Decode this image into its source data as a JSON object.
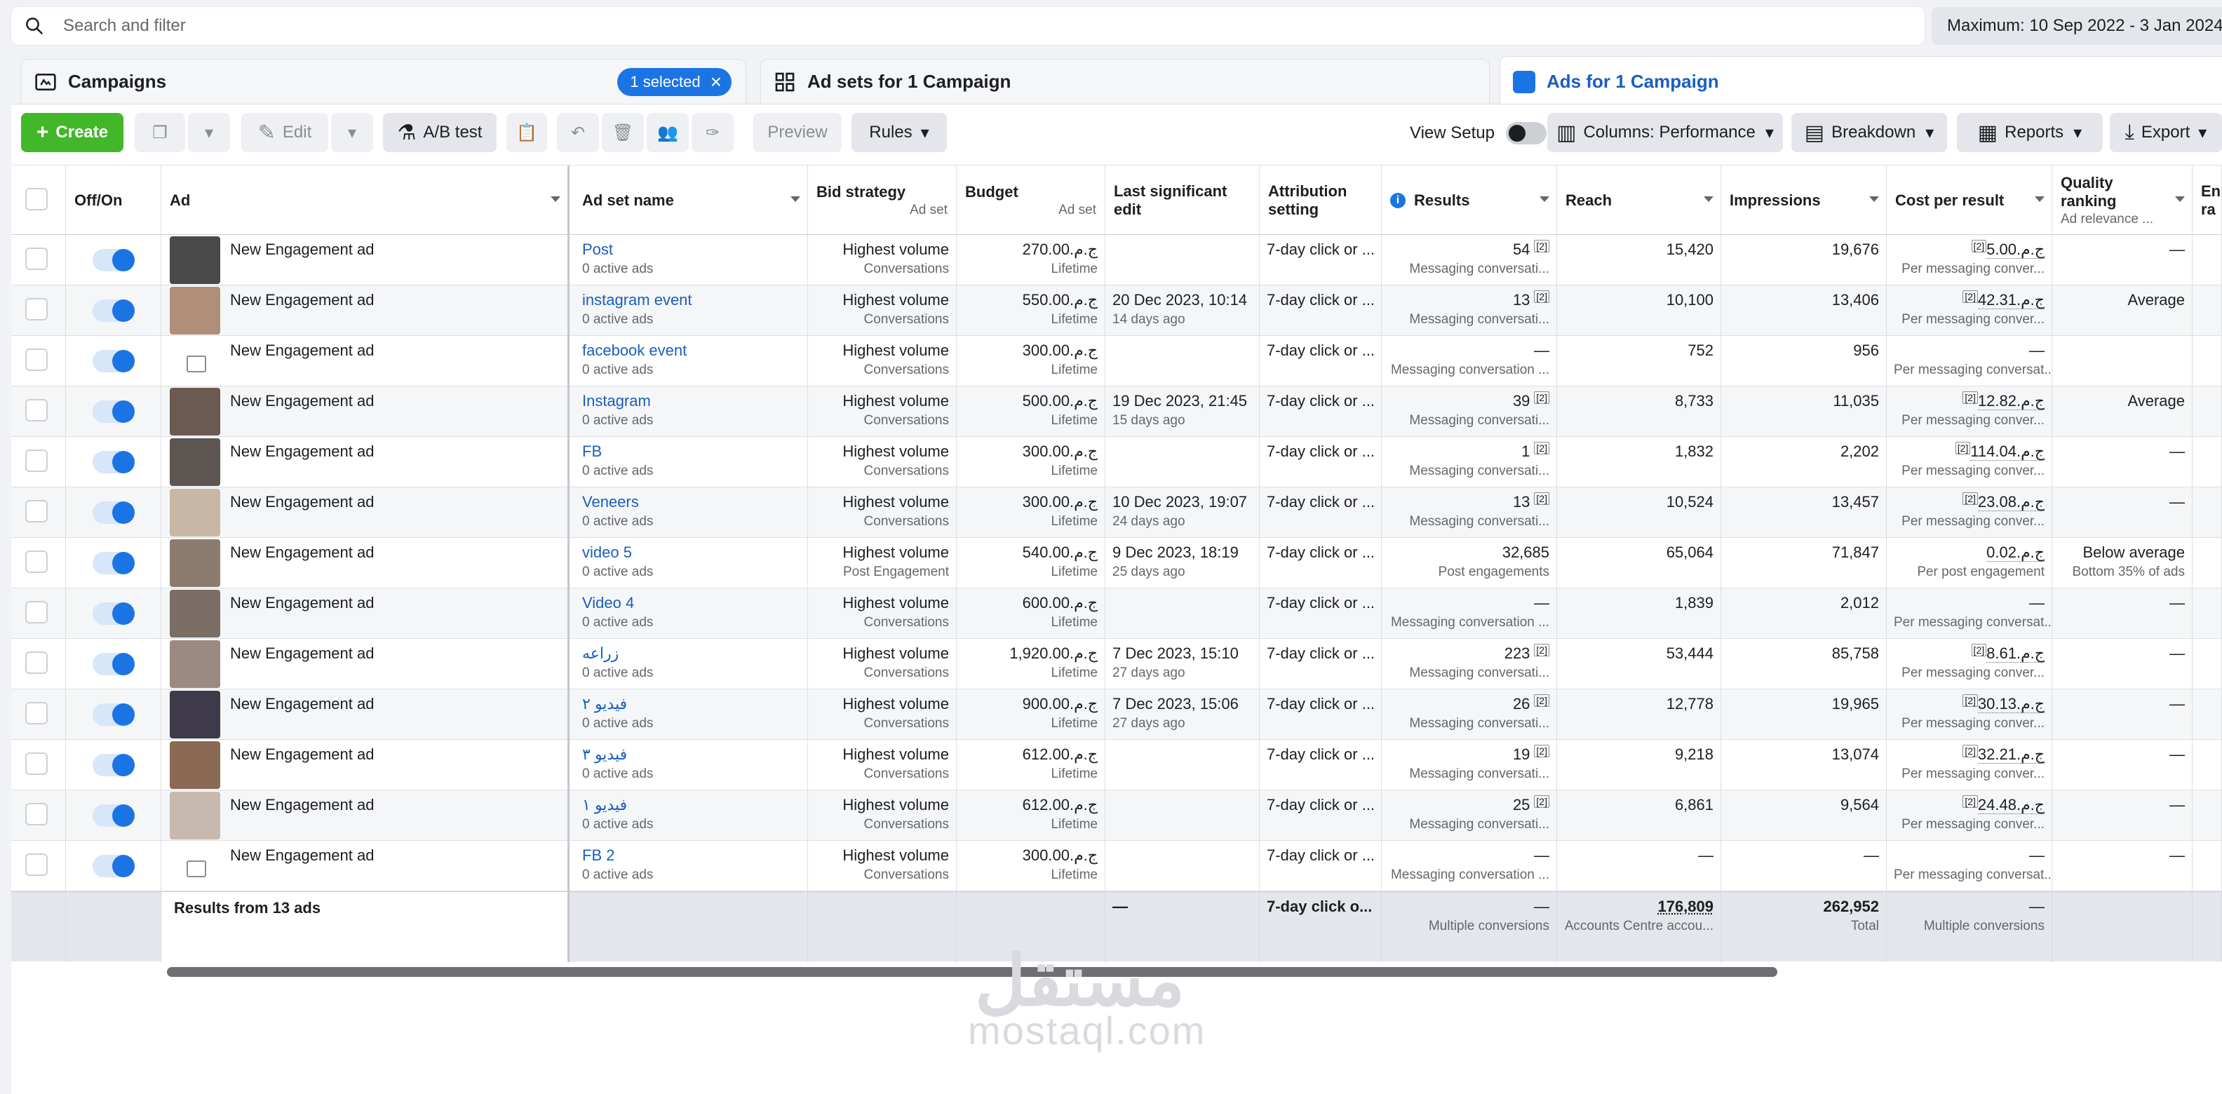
{
  "search": {
    "placeholder": "Search and filter"
  },
  "date_range": "Maximum: 10 Sep 2022 - 3 Jan 2024",
  "tabs": {
    "campaigns": "Campaigns",
    "selected_pill": "1 selected",
    "adsets": "Ad sets for 1 Campaign",
    "ads": "Ads for 1 Campaign"
  },
  "toolbar": {
    "create": "Create",
    "edit": "Edit",
    "ab_test": "A/B test",
    "preview": "Preview",
    "rules": "Rules",
    "view_setup": "View Setup",
    "columns": "Columns: Performance",
    "breakdown": "Breakdown",
    "reports": "Reports",
    "export": "Export"
  },
  "headers": {
    "offon": "Off/On",
    "ad": "Ad",
    "adset": "Ad set name",
    "bid": "Bid strategy",
    "bid_sub": "Ad set",
    "budget": "Budget",
    "budget_sub": "Ad set",
    "lastedit": "Last significant edit",
    "attribution": "Attribution setting",
    "results": "Results",
    "reach": "Reach",
    "impressions": "Impressions",
    "cpr": "Cost per result",
    "quality": "Quality ranking",
    "quality_sub": "Ad relevance ...",
    "er": "En ra"
  },
  "rows": [
    {
      "ad": "New Engagement ad",
      "adset": "Post",
      "adset_sub": "0 active ads",
      "bid": "Highest volume",
      "bid_sub": "Conversations",
      "budget": "ج.م.270.00",
      "budget_sub": "Lifetime",
      "edit": "",
      "edit_sub": "",
      "attr": "7-day click or ...",
      "results": "54",
      "results_sub": "Messaging conversati...",
      "reach": "15,420",
      "impr": "19,676",
      "cpr": "ج.م.5.00",
      "cpr_sub": "Per messaging conver...",
      "quality": "—",
      "quality_sub": "",
      "thumb": "#4a4a4a"
    },
    {
      "ad": "New Engagement ad",
      "adset": "instagram event",
      "adset_sub": "0 active ads",
      "bid": "Highest volume",
      "bid_sub": "Conversations",
      "budget": "ج.م.550.00",
      "budget_sub": "Lifetime",
      "edit": "20 Dec 2023, 10:14",
      "edit_sub": "14 days ago",
      "attr": "7-day click or ...",
      "results": "13",
      "results_sub": "Messaging conversati...",
      "reach": "10,100",
      "impr": "13,406",
      "cpr": "ج.م.42.31",
      "cpr_sub": "Per messaging conver...",
      "quality": "Average",
      "quality_sub": "",
      "thumb": "#b08f7a"
    },
    {
      "ad": "New Engagement ad",
      "adset": "facebook event",
      "adset_sub": "0 active ads",
      "bid": "Highest volume",
      "bid_sub": "Conversations",
      "budget": "ج.م.300.00",
      "budget_sub": "Lifetime",
      "edit": "",
      "edit_sub": "",
      "attr": "7-day click or ...",
      "results": "—",
      "results_sub": "Messaging conversation ...",
      "reach": "752",
      "impr": "956",
      "cpr": "—",
      "cpr_sub": "Per messaging conversat...",
      "quality": "",
      "quality_sub": "",
      "thumb": ""
    },
    {
      "ad": "New Engagement ad",
      "adset": "Instagram",
      "adset_sub": "0 active ads",
      "bid": "Highest volume",
      "bid_sub": "Conversations",
      "budget": "ج.م.500.00",
      "budget_sub": "Lifetime",
      "edit": "19 Dec 2023, 21:45",
      "edit_sub": "15 days ago",
      "attr": "7-day click or ...",
      "results": "39",
      "results_sub": "Messaging conversati...",
      "reach": "8,733",
      "impr": "11,035",
      "cpr": "ج.م.12.82",
      "cpr_sub": "Per messaging conver...",
      "quality": "Average",
      "quality_sub": "",
      "thumb": "#6b5a52"
    },
    {
      "ad": "New Engagement ad",
      "adset": "FB",
      "adset_sub": "0 active ads",
      "bid": "Highest volume",
      "bid_sub": "Conversations",
      "budget": "ج.م.300.00",
      "budget_sub": "Lifetime",
      "edit": "",
      "edit_sub": "",
      "attr": "7-day click or ...",
      "results": "1",
      "results_sub": "Messaging conversati...",
      "reach": "1,832",
      "impr": "2,202",
      "cpr": "ج.م.114.04",
      "cpr_sub": "Per messaging conver...",
      "quality": "—",
      "quality_sub": "",
      "thumb": "#5c5552"
    },
    {
      "ad": "New Engagement ad",
      "adset": "Veneers",
      "adset_sub": "0 active ads",
      "bid": "Highest volume",
      "bid_sub": "Conversations",
      "budget": "ج.م.300.00",
      "budget_sub": "Lifetime",
      "edit": "10 Dec 2023, 19:07",
      "edit_sub": "24 days ago",
      "attr": "7-day click or ...",
      "results": "13",
      "results_sub": "Messaging conversati...",
      "reach": "10,524",
      "impr": "13,457",
      "cpr": "ج.م.23.08",
      "cpr_sub": "Per messaging conver...",
      "quality": "—",
      "quality_sub": "",
      "thumb": "#c9b7a5"
    },
    {
      "ad": "New Engagement ad",
      "adset": "video 5",
      "adset_sub": "0 active ads",
      "bid": "Highest volume",
      "bid_sub": "Post Engagement",
      "budget": "ج.م.540.00",
      "budget_sub": "Lifetime",
      "edit": "9 Dec 2023, 18:19",
      "edit_sub": "25 days ago",
      "attr": "7-day click or ...",
      "results": "32,685",
      "results_sub": "Post engagements",
      "reach": "65,064",
      "impr": "71,847",
      "cpr": "ج.م.0.02",
      "cpr_sub": "Per post engagement",
      "quality": "Below average",
      "quality_sub": "Bottom 35% of ads",
      "thumb": "#8c7b6f"
    },
    {
      "ad": "New Engagement ad",
      "adset": "Video 4",
      "adset_sub": "0 active ads",
      "bid": "Highest volume",
      "bid_sub": "Conversations",
      "budget": "ج.م.600.00",
      "budget_sub": "Lifetime",
      "edit": "",
      "edit_sub": "",
      "attr": "7-day click or ...",
      "results": "—",
      "results_sub": "Messaging conversation ...",
      "reach": "1,839",
      "impr": "2,012",
      "cpr": "—",
      "cpr_sub": "Per messaging conversat...",
      "quality": "—",
      "quality_sub": "",
      "thumb": "#7a6e66"
    },
    {
      "ad": "New Engagement ad",
      "adset": "زراعه",
      "adset_sub": "0 active ads",
      "bid": "Highest volume",
      "bid_sub": "Conversations",
      "budget": "ج.م.1,920.00",
      "budget_sub": "Lifetime",
      "edit": "7 Dec 2023, 15:10",
      "edit_sub": "27 days ago",
      "attr": "7-day click or ...",
      "results": "223",
      "results_sub": "Messaging conversati...",
      "reach": "53,444",
      "impr": "85,758",
      "cpr": "ج.م.8.61",
      "cpr_sub": "Per messaging conver...",
      "quality": "—",
      "quality_sub": "",
      "thumb": "#9a8a80"
    },
    {
      "ad": "New Engagement ad",
      "adset": "فيديو ٢",
      "adset_sub": "0 active ads",
      "bid": "Highest volume",
      "bid_sub": "Conversations",
      "budget": "ج.م.900.00",
      "budget_sub": "Lifetime",
      "edit": "7 Dec 2023, 15:06",
      "edit_sub": "27 days ago",
      "attr": "7-day click or ...",
      "results": "26",
      "results_sub": "Messaging conversati...",
      "reach": "12,778",
      "impr": "19,965",
      "cpr": "ج.م.30.13",
      "cpr_sub": "Per messaging conver...",
      "quality": "—",
      "quality_sub": "",
      "thumb": "#3e3a4a"
    },
    {
      "ad": "New Engagement ad",
      "adset": "فيديو ٣",
      "adset_sub": "0 active ads",
      "bid": "Highest volume",
      "bid_sub": "Conversations",
      "budget": "ج.م.612.00",
      "budget_sub": "Lifetime",
      "edit": "",
      "edit_sub": "",
      "attr": "7-day click or ...",
      "results": "19",
      "results_sub": "Messaging conversati...",
      "reach": "9,218",
      "impr": "13,074",
      "cpr": "ج.م.32.21",
      "cpr_sub": "Per messaging conver...",
      "quality": "—",
      "quality_sub": "",
      "thumb": "#8a6a55"
    },
    {
      "ad": "New Engagement ad",
      "adset": "فيديو ١",
      "adset_sub": "0 active ads",
      "bid": "Highest volume",
      "bid_sub": "Conversations",
      "budget": "ج.م.612.00",
      "budget_sub": "Lifetime",
      "edit": "",
      "edit_sub": "",
      "attr": "7-day click or ...",
      "results": "25",
      "results_sub": "Messaging conversati...",
      "reach": "6,861",
      "impr": "9,564",
      "cpr": "ج.م.24.48",
      "cpr_sub": "Per messaging conver...",
      "quality": "—",
      "quality_sub": "",
      "thumb": "#c7b9ad"
    },
    {
      "ad": "New Engagement ad",
      "adset": "FB 2",
      "adset_sub": "0 active ads",
      "bid": "Highest volume",
      "bid_sub": "Conversations",
      "budget": "ج.م.300.00",
      "budget_sub": "Lifetime",
      "edit": "",
      "edit_sub": "",
      "attr": "7-day click or ...",
      "results": "—",
      "results_sub": "Messaging conversation ...",
      "reach": "—",
      "impr": "—",
      "cpr": "—",
      "cpr_sub": "Per messaging conversat...",
      "quality": "—",
      "quality_sub": "",
      "thumb": ""
    }
  ],
  "sup_label": "[2]",
  "footer": {
    "label": "Results from 13 ads",
    "edit": "—",
    "attr": "7-day click o...",
    "results": "—",
    "results_sub": "Multiple conversions",
    "reach": "176,809",
    "reach_sub": "Accounts Centre accou...",
    "impr": "262,952",
    "impr_sub": "Total",
    "cpr": "—",
    "cpr_sub": "Multiple conversions"
  },
  "watermark": {
    "arabic": "مستقل",
    "latin": "mostaql.com"
  },
  "colors": {
    "accent": "#1b74e4",
    "create": "#42b72a",
    "link": "#1a5ebf"
  }
}
